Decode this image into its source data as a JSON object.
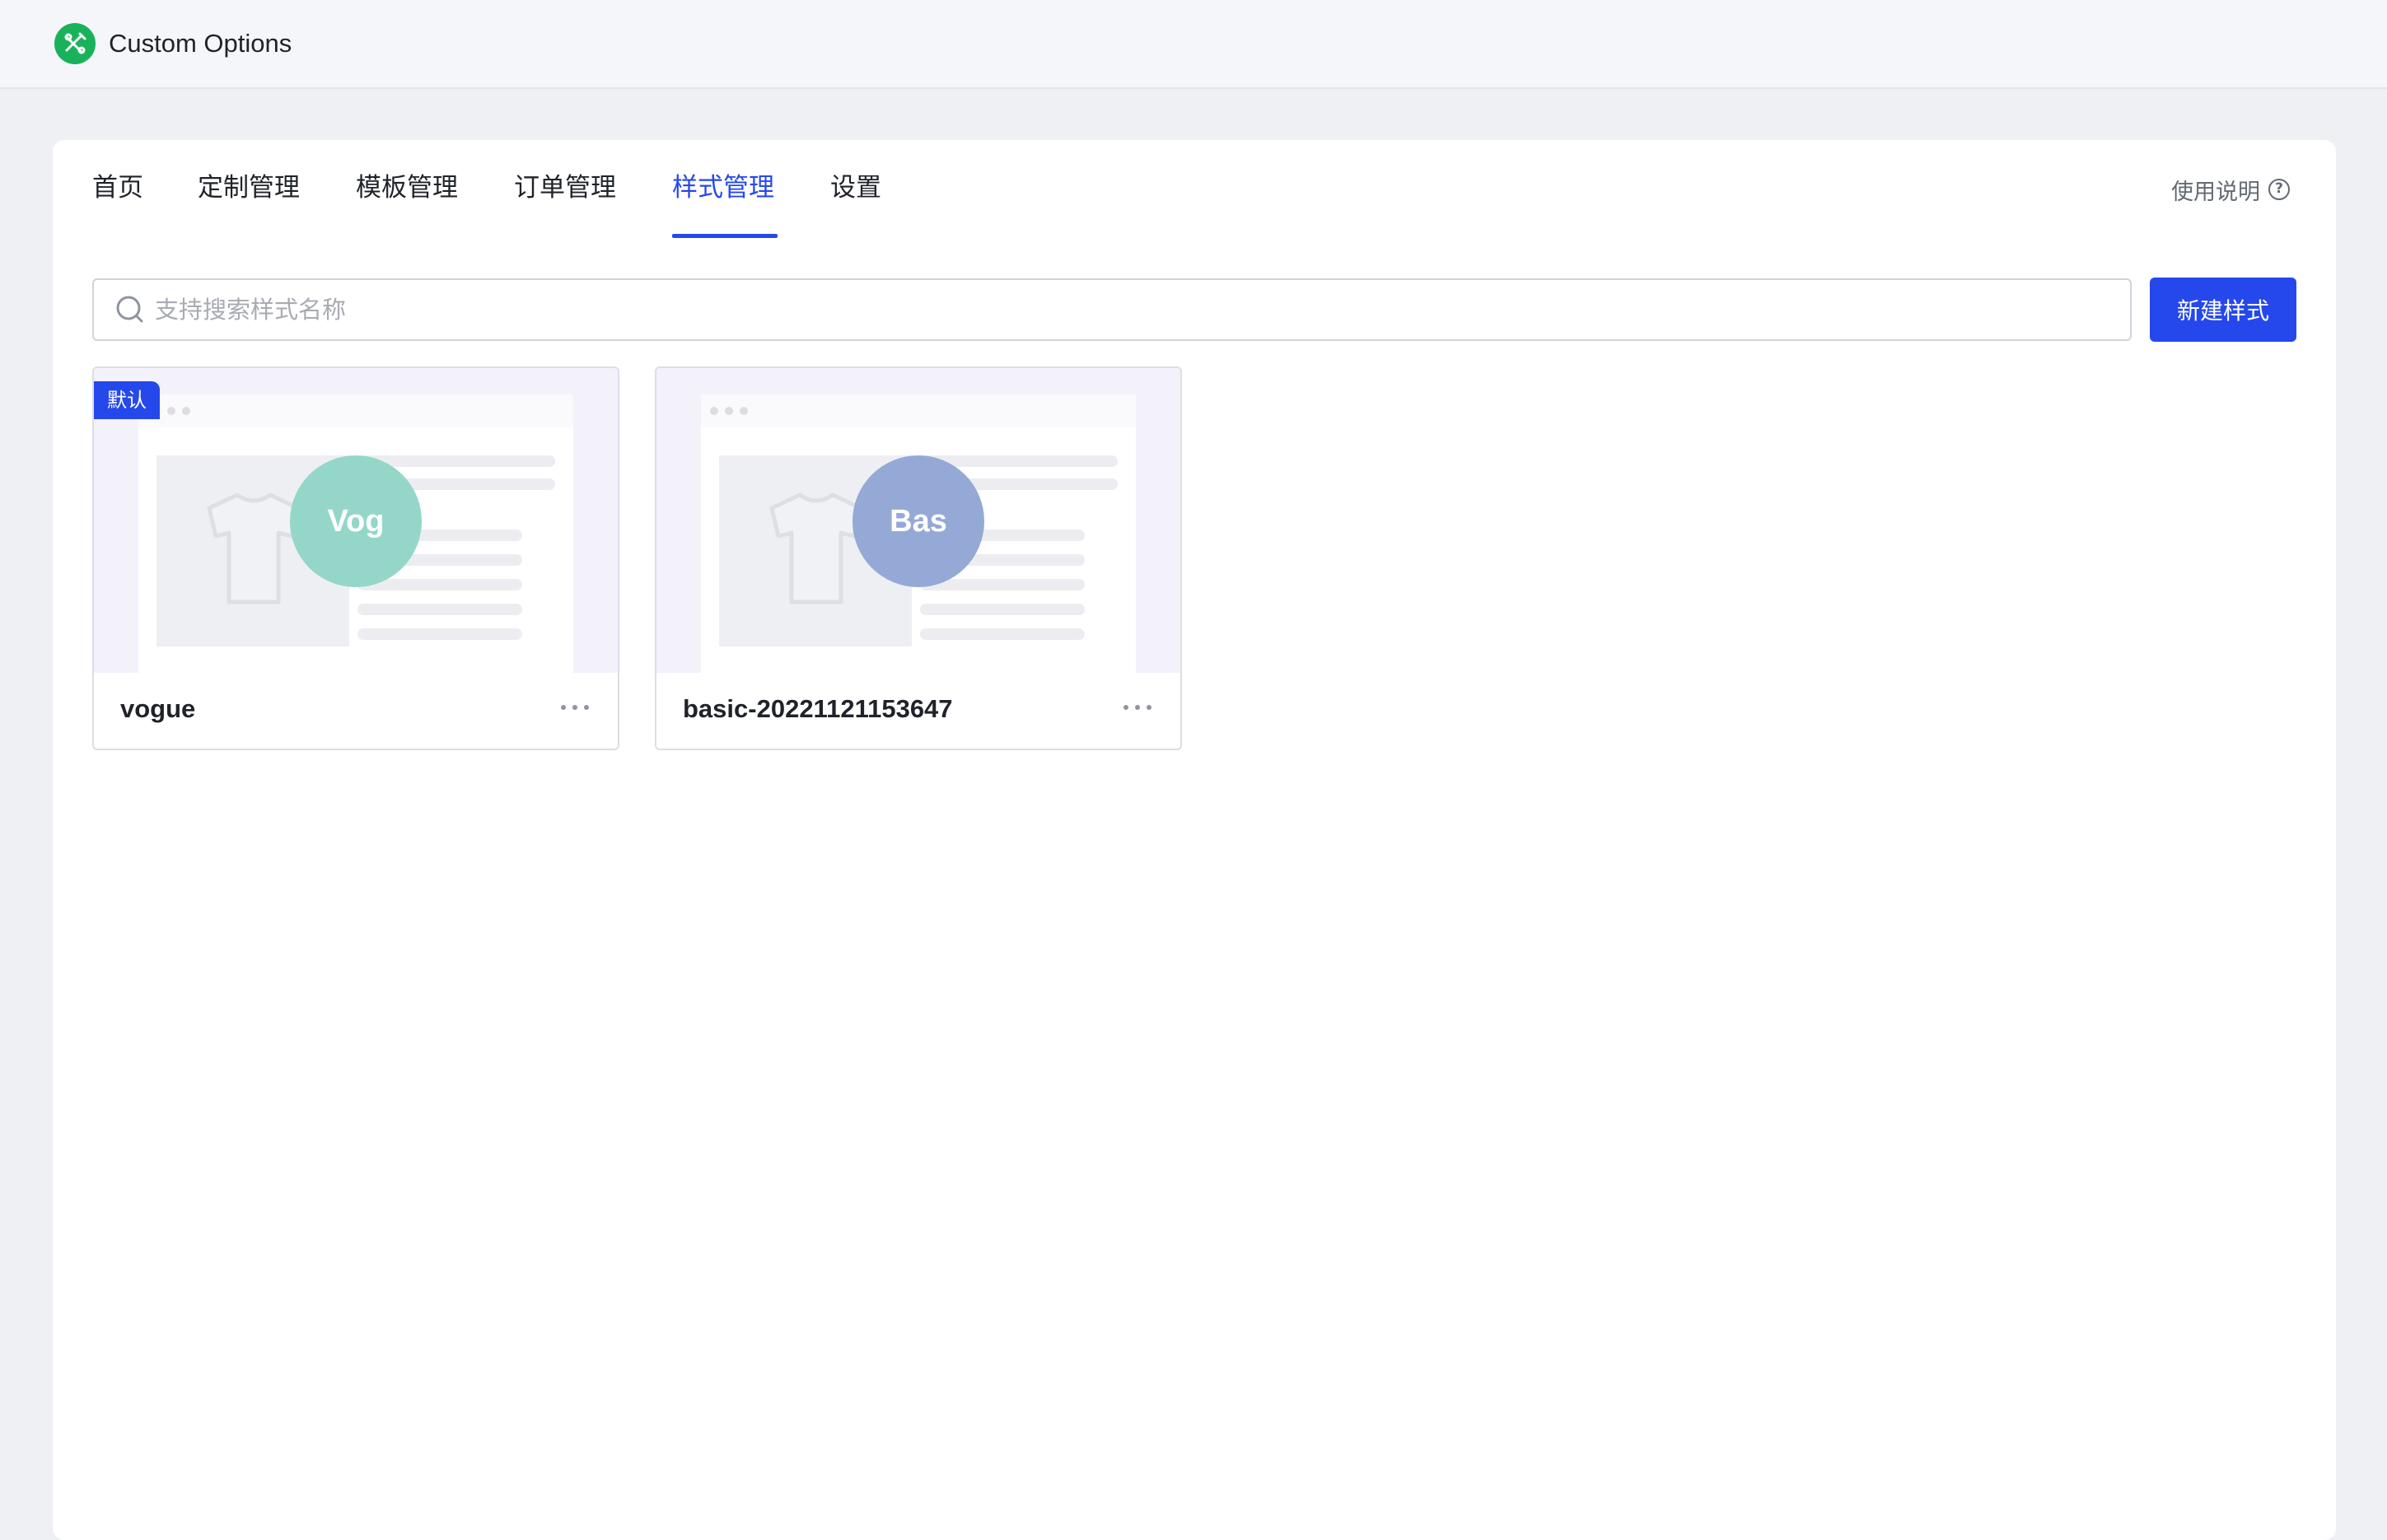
{
  "app": {
    "title": "Custom Options"
  },
  "nav": {
    "tabs": [
      {
        "label": "首页",
        "active": false
      },
      {
        "label": "定制管理",
        "active": false
      },
      {
        "label": "模板管理",
        "active": false
      },
      {
        "label": "订单管理",
        "active": false
      },
      {
        "label": "样式管理",
        "active": true
      },
      {
        "label": "设置",
        "active": false
      }
    ],
    "help_label": "使用说明",
    "help_icon": "question-circle-icon"
  },
  "search": {
    "placeholder": "支持搜索样式名称",
    "value": ""
  },
  "toolbar": {
    "new_style_label": "新建样式"
  },
  "styles": [
    {
      "name": "vogue",
      "avatar_text": "Vog",
      "avatar_color": "#94d7c8",
      "default_badge": "默认",
      "more_icon": "ellipsis-icon"
    },
    {
      "name": "basic-20221121153647",
      "avatar_text": "Bas",
      "avatar_color": "#94a9d6",
      "more_icon": "ellipsis-icon"
    }
  ],
  "colors": {
    "accent": "#2548ec",
    "logo_green": "#19b25a",
    "page_bg": "#eef0f3",
    "preview_bg": "#f3f2fb"
  }
}
